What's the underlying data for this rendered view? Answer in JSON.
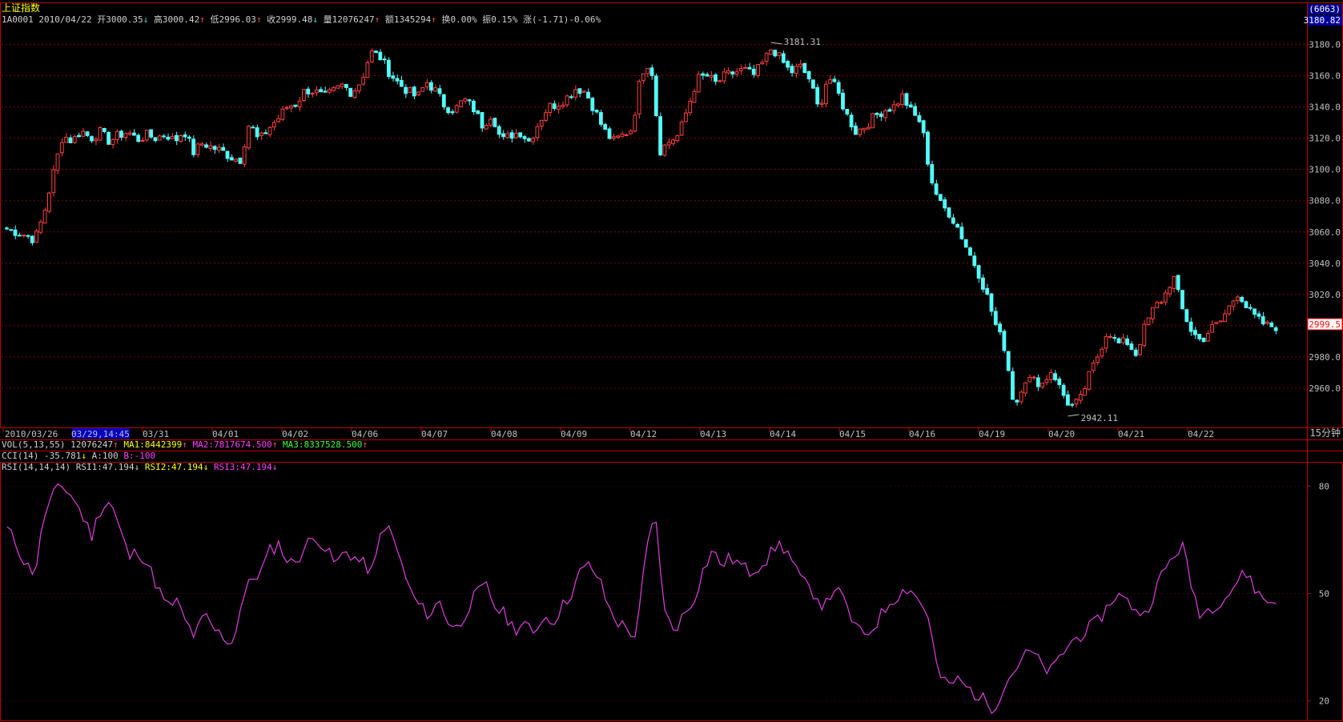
{
  "header": {
    "title": "上证指数",
    "code": "1A0001",
    "date": "2010/04/22",
    "open_label": "开",
    "open": "3000.35",
    "high_label": "高",
    "high": "3000.42",
    "low_label": "低",
    "low": "2996.03",
    "close_label": "收",
    "close": "2999.48",
    "vol_label": "量",
    "vol": "12076247",
    "amount_label": "额",
    "amount": "1345294",
    "turnover_label": "换",
    "turnover": "0.00%",
    "amplitude_label": "振",
    "amplitude": "0.15%",
    "change_label": "涨",
    "change": "(-1.71)-0.06%",
    "arrows": {
      "open": "↓",
      "high": "↑",
      "low": "↑",
      "close": "↓",
      "vol": "↑",
      "amount": "↑"
    }
  },
  "side": {
    "count": "(6063)",
    "top_price": "3180.82",
    "current_price": "2999.5",
    "period": "15分钟"
  },
  "indicators": {
    "vol_name": "VOL(5,13,55)",
    "vol_value": "12076247",
    "ma1": "MA1:8442399",
    "ma2": "MA2:7817674.500",
    "ma3": "MA3:8337528.500",
    "cci_name": "CCI(14)",
    "cci_value": "-35.781",
    "cci_a": "A:100",
    "cci_b": "B:-100",
    "rsi_name": "RSI(14,14,14)",
    "rsi1": "RSI1:47.194",
    "rsi2": "RSI2:47.194",
    "rsi3": "RSI3:47.194"
  },
  "colors": {
    "up": "#ff4040",
    "down": "#54fcfc",
    "rsi": "#e040e0",
    "grid": "#800000",
    "axis": "#c00000"
  },
  "chart_data": [
    {
      "type": "candlestick",
      "ylim": [
        2940,
        3190
      ],
      "yticks": [
        "3180.0",
        "3160.0",
        "3140.0",
        "3120.0",
        "3100.0",
        "3080.0",
        "3060.0",
        "3040.0",
        "3020.0",
        "3000.0",
        "2980.0",
        "2960.0"
      ],
      "x_labels": [
        "2010/03/26",
        "03/29,14:45",
        "03/31",
        "04/01",
        "04/02",
        "04/06",
        "04/07",
        "04/08",
        "04/09",
        "04/12",
        "04/13",
        "04/14",
        "04/15",
        "04/16",
        "04/19",
        "04/20",
        "04/21",
        "04/22"
      ],
      "annotations": [
        {
          "label": "3181.31",
          "value": 3181.31
        },
        {
          "label": "2942.11",
          "value": 2942.11
        }
      ],
      "anchors": [
        3062,
        3060,
        3058,
        3055,
        3072,
        3098,
        3122,
        3118,
        3125,
        3120,
        3124,
        3118,
        3122,
        3124,
        3119,
        3122,
        3120,
        3123,
        3118,
        3125,
        3111,
        3117,
        3114,
        3112,
        3108,
        3106,
        3130,
        3118,
        3126,
        3132,
        3140,
        3142,
        3151,
        3150,
        3146,
        3150,
        3154,
        3149,
        3157,
        3175,
        3172,
        3162,
        3155,
        3150,
        3146,
        3156,
        3150,
        3140,
        3138,
        3145,
        3139,
        3128,
        3136,
        3118,
        3122,
        3124,
        3118,
        3130,
        3140,
        3142,
        3146,
        3152,
        3150,
        3138,
        3125,
        3118,
        3122,
        3126,
        3162,
        3170,
        3112,
        3118,
        3122,
        3140,
        3158,
        3160,
        3155,
        3160,
        3162,
        3164,
        3160,
        3168,
        3178,
        3170,
        3162,
        3166,
        3158,
        3138,
        3160,
        3150,
        3135,
        3124,
        3128,
        3134,
        3138,
        3140,
        3147,
        3136,
        3130,
        3095,
        3078,
        3072,
        3062,
        3048,
        3036,
        3020,
        3000,
        2985,
        2947,
        2966,
        2965,
        2963,
        2972,
        2958,
        2948,
        2952,
        2968,
        2982,
        2998,
        2988,
        2990,
        2982,
        3000,
        3012,
        3018,
        3032,
        3010,
        2996,
        2990,
        2998,
        3002,
        3012,
        3022,
        3010,
        3004,
        3000,
        2999.5
      ],
      "volatility": 4
    },
    {
      "type": "line",
      "series": [
        {
          "name": "RSI1"
        }
      ],
      "ylim": [
        15,
        85
      ],
      "yticks": [
        "80",
        "50",
        "20"
      ],
      "values": [
        68,
        64,
        58,
        56,
        72,
        78,
        80,
        77,
        72,
        66,
        74,
        76,
        68,
        60,
        62,
        58,
        52,
        46,
        48,
        42,
        38,
        44,
        40,
        38,
        36,
        48,
        54,
        56,
        62,
        64,
        58,
        60,
        64,
        66,
        62,
        58,
        62,
        60,
        58,
        56,
        70,
        66,
        58,
        50,
        46,
        44,
        48,
        42,
        40,
        46,
        50,
        52,
        46,
        44,
        40,
        42,
        38,
        44,
        42,
        46,
        50,
        56,
        58,
        54,
        46,
        42,
        40,
        38,
        62,
        72,
        44,
        40,
        44,
        48,
        56,
        62,
        58,
        60,
        58,
        56,
        58,
        60,
        64,
        62,
        56,
        52,
        50,
        46,
        52,
        48,
        42,
        38,
        40,
        44,
        48,
        50,
        52,
        48,
        44,
        28,
        24,
        26,
        24,
        22,
        20,
        18,
        24,
        28,
        32,
        34,
        30,
        28,
        32,
        36,
        38,
        40,
        42,
        46,
        50,
        48,
        46,
        44,
        50,
        56,
        60,
        64,
        52,
        44,
        46,
        48,
        50,
        54,
        56,
        50,
        48,
        47.194
      ]
    }
  ]
}
